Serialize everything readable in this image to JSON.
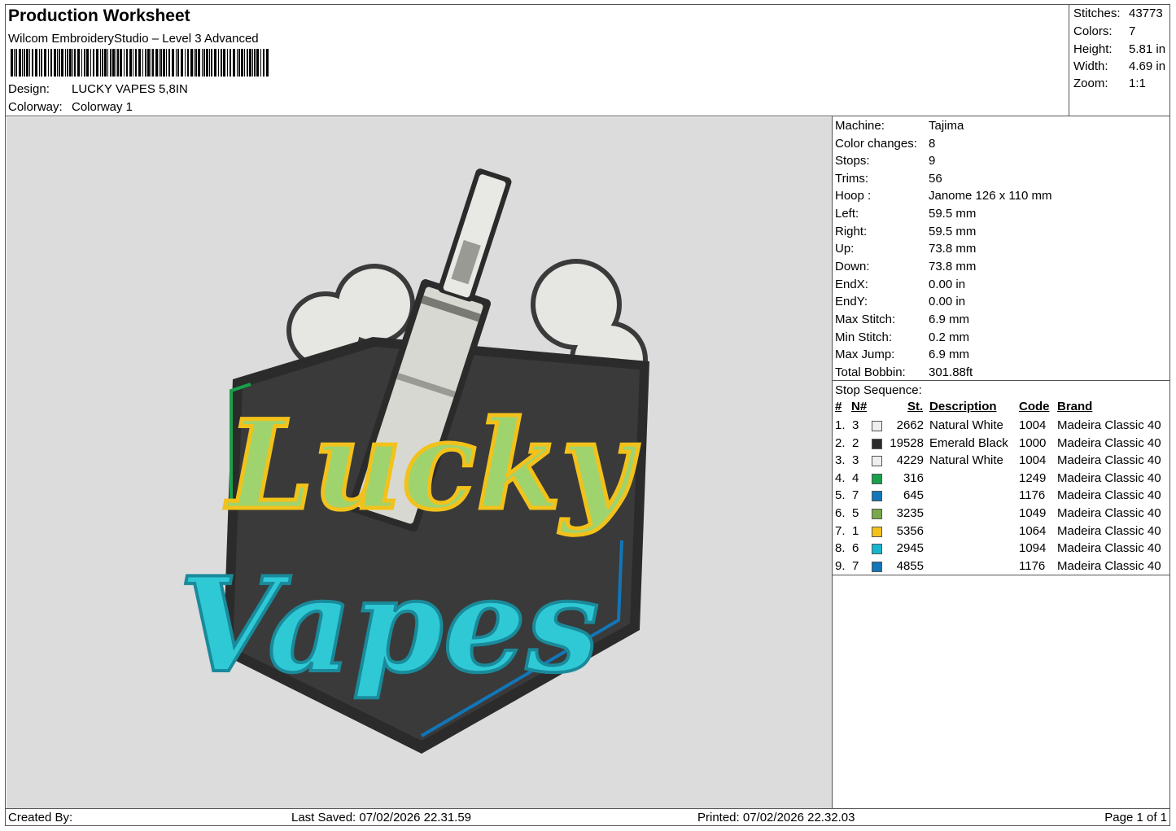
{
  "header": {
    "title": "Production Worksheet",
    "software": "Wilcom EmbroideryStudio – Level 3 Advanced",
    "design_label": "Design:",
    "design_value": "LUCKY VAPES 5,8IN",
    "colorway_label": "Colorway:",
    "colorway_value": "Colorway 1"
  },
  "stats": [
    {
      "label": "Stitches:",
      "value": "43773"
    },
    {
      "label": "Colors:",
      "value": "7"
    },
    {
      "label": "Height:",
      "value": "5.81 in"
    },
    {
      "label": "Width:",
      "value": "4.69 in"
    },
    {
      "label": "Zoom:",
      "value": "1:1"
    }
  ],
  "machine_info": [
    {
      "label": "Machine:",
      "value": "Tajima"
    },
    {
      "label": "Color changes:",
      "value": "8"
    },
    {
      "label": "Stops:",
      "value": "9"
    },
    {
      "label": "Trims:",
      "value": "56"
    },
    {
      "label": "Hoop :",
      "value": "Janome 126 x 110 mm"
    },
    {
      "label": "Left:",
      "value": "59.5 mm"
    },
    {
      "label": "Right:",
      "value": "59.5 mm"
    },
    {
      "label": "Up:",
      "value": "73.8 mm"
    },
    {
      "label": "Down:",
      "value": "73.8 mm"
    },
    {
      "label": "EndX:",
      "value": "0.00 in"
    },
    {
      "label": "EndY:",
      "value": "0.00 in"
    },
    {
      "label": "Max Stitch:",
      "value": "6.9 mm"
    },
    {
      "label": "Min Stitch:",
      "value": "0.2 mm"
    },
    {
      "label": "Max Jump:",
      "value": "6.9 mm"
    },
    {
      "label": "Total Bobbin:",
      "value": "301.88ft"
    }
  ],
  "stop_sequence": {
    "title": "Stop Sequence:",
    "columns": {
      "num": "#",
      "needle": "N#",
      "stitches": "St.",
      "description": "Description",
      "code": "Code",
      "brand": "Brand"
    },
    "rows": [
      {
        "num": "1.",
        "needle": "3",
        "color": "#eeeeee",
        "stitches": "2662",
        "description": "Natural White",
        "code": "1004",
        "brand": "Madeira Classic 40"
      },
      {
        "num": "2.",
        "needle": "2",
        "color": "#2b2b2b",
        "stitches": "19528",
        "description": "Emerald Black",
        "code": "1000",
        "brand": "Madeira Classic 40"
      },
      {
        "num": "3.",
        "needle": "3",
        "color": "#eeeeee",
        "stitches": "4229",
        "description": "Natural White",
        "code": "1004",
        "brand": "Madeira Classic 40"
      },
      {
        "num": "4.",
        "needle": "4",
        "color": "#1aa04a",
        "stitches": "316",
        "description": "",
        "code": "1249",
        "brand": "Madeira Classic 40"
      },
      {
        "num": "5.",
        "needle": "7",
        "color": "#1276b8",
        "stitches": "645",
        "description": "",
        "code": "1176",
        "brand": "Madeira Classic 40"
      },
      {
        "num": "6.",
        "needle": "5",
        "color": "#78a84a",
        "stitches": "3235",
        "description": "",
        "code": "1049",
        "brand": "Madeira Classic 40"
      },
      {
        "num": "7.",
        "needle": "1",
        "color": "#f2c21b",
        "stitches": "5356",
        "description": "",
        "code": "1064",
        "brand": "Madeira Classic 40"
      },
      {
        "num": "8.",
        "needle": "6",
        "color": "#16b6cf",
        "stitches": "2945",
        "description": "",
        "code": "1094",
        "brand": "Madeira Classic 40"
      },
      {
        "num": "9.",
        "needle": "7",
        "color": "#1276b8",
        "stitches": "4855",
        "description": "",
        "code": "1176",
        "brand": "Madeira Classic 40"
      }
    ]
  },
  "design": {
    "word1": "Lucky",
    "word2": "Vapes",
    "colors": {
      "patch": "#3a3a3a",
      "border": "#2b2b2b",
      "smoke": "#e6e6e2",
      "lucky_fill": "#9fd36e",
      "lucky_outline": "#f2c21b",
      "vapes_fill": "#2fc9d6",
      "green_line": "#1aa04a",
      "blue_line": "#1276b8"
    }
  },
  "footer": {
    "created_by": "Created By:",
    "last_saved": "Last Saved: 07/02/2026 22.31.59",
    "printed": "Printed: 07/02/2026 22.32.03",
    "page": "Page 1 of 1"
  }
}
